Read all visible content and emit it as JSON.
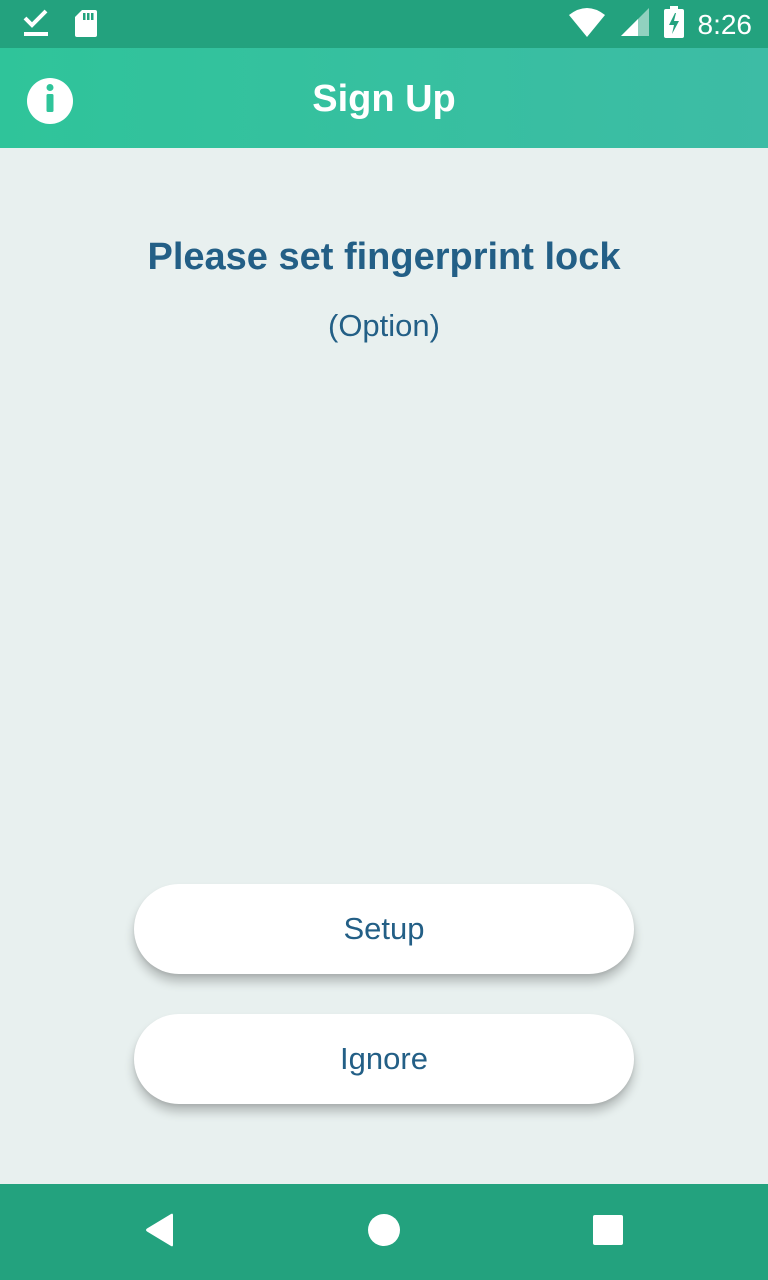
{
  "status_bar": {
    "time": "8:26",
    "icons": [
      "download-done-icon",
      "sd-card-icon",
      "wifi-icon",
      "cell-signal-icon",
      "battery-charging-icon"
    ]
  },
  "app_bar": {
    "title": "Sign Up",
    "info_icon": "info-icon"
  },
  "content": {
    "heading": "Please set fingerprint lock",
    "subheading": "(Option)"
  },
  "buttons": {
    "setup_label": "Setup",
    "ignore_label": "Ignore"
  },
  "nav_bar": {
    "icons": [
      "back-icon",
      "home-icon",
      "recents-icon"
    ]
  },
  "colors": {
    "status_bar": "#23a27e",
    "app_bar_start": "#2fc49a",
    "app_bar_end": "#3dbca5",
    "background": "#e8f0ef",
    "text_primary": "#235f86",
    "button_bg": "#ffffff"
  }
}
